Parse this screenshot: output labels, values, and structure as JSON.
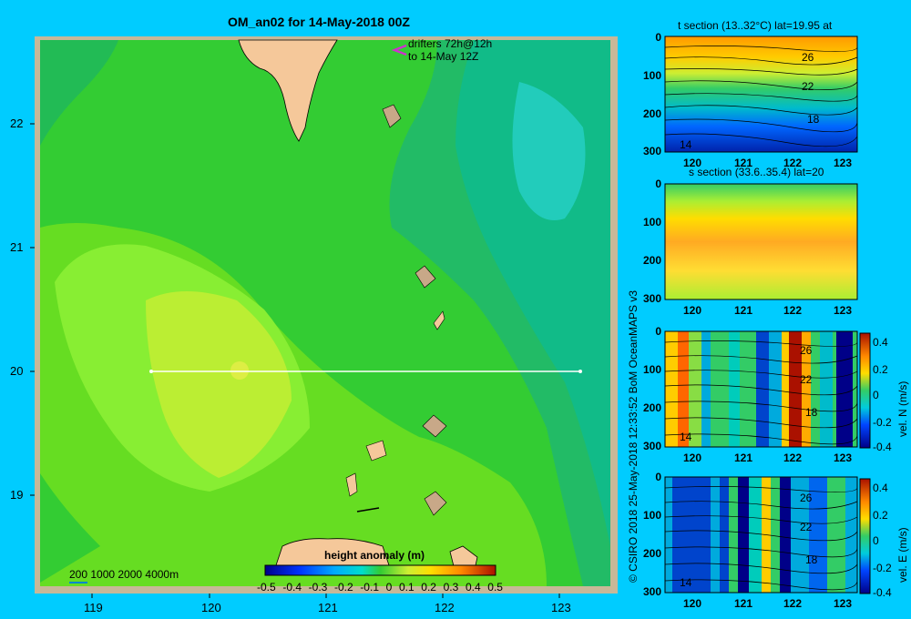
{
  "title": "OM_an02 for 14-May-2018 00Z",
  "drifters": {
    "line1": "drifters 72h@12h",
    "line2": "to 14-May 12Z"
  },
  "main_axes": {
    "x_ticks": [
      "119",
      "120",
      "121",
      "122",
      "123"
    ],
    "y_ticks": [
      "22",
      "21",
      "20",
      "19"
    ]
  },
  "depth_legend": "200  1000  2000  4000m",
  "colorbar": {
    "title": "height anomaly (m)",
    "ticks": [
      "-0.5",
      "-0.4",
      "-0.3",
      "-0.2",
      "-0.1",
      "0",
      "0.1",
      "0.2",
      "0.3",
      "0.4",
      "0.5"
    ]
  },
  "credit": "© CSIRO 2018   25-May-2018 12:33:52 BoM OceanMAPS v3",
  "panels": [
    {
      "title": "t section (13..32°C) lat=19.95 at",
      "contours": [
        "26",
        "22",
        "18",
        "14"
      ]
    },
    {
      "title": "s section (33.6..35.4) lat=20",
      "contours": []
    },
    {
      "title": "",
      "contours": [
        "26",
        "22",
        "18",
        "14"
      ],
      "cbar_label": "vel. N  (m/s)",
      "cbar_ticks": [
        "0.4",
        "0.2",
        "0",
        "-0.2",
        "-0.4"
      ]
    },
    {
      "title": "",
      "contours": [
        "26",
        "22",
        "18",
        "14"
      ],
      "cbar_label": "vel. E  (m/s)",
      "cbar_ticks": [
        "0.4",
        "0.2",
        "0",
        "-0.2",
        "-0.4"
      ]
    }
  ],
  "panel_axes": {
    "depth_ticks": [
      "0",
      "100",
      "200",
      "300"
    ],
    "lon_ticks": [
      "120",
      "121",
      "122",
      "123"
    ]
  },
  "colors": {
    "background": "#00ccff",
    "land": "#f5c89a",
    "frame": "#c8b898",
    "section_line": "#ffffff",
    "drifter": "#cc33cc"
  }
}
